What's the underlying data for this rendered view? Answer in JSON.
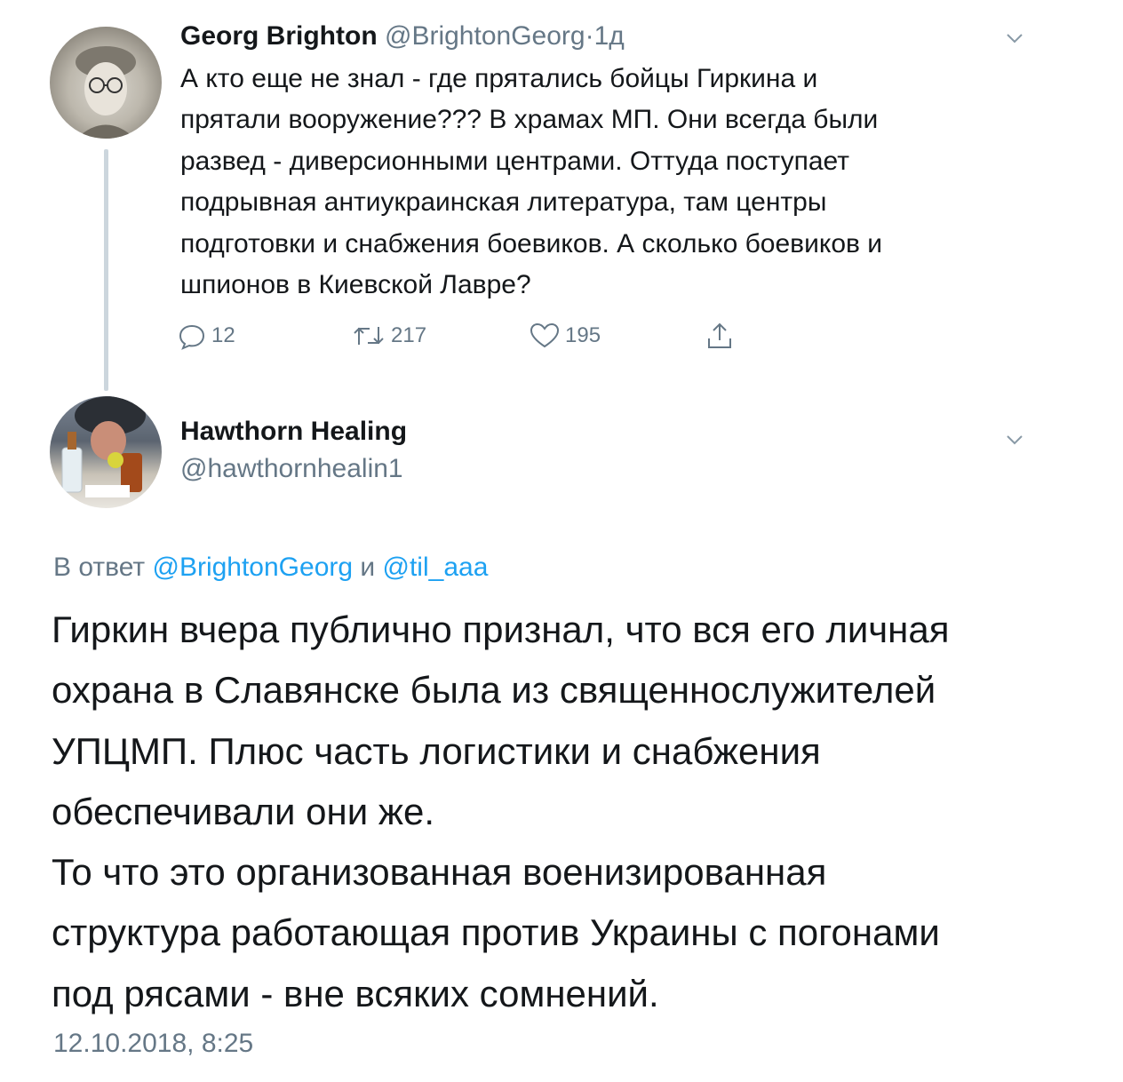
{
  "tweet1": {
    "name": "Georg Brighton",
    "handle": "@BrightonGeorg",
    "separator": "·",
    "age": "1д",
    "text": "А кто еще не знал - где прятались бойцы Гиркина и\nпрятали вооружение??? В храмах МП. Они всегда были\nразвед - диверсионными центрами. Оттуда поступает\nподрывная антиукраинская литература, там центры\nподготовки и снабжения боевиков. А сколько боевиков и\nшпионов в Киевской Лавре?",
    "replies": "12",
    "retweets": "217",
    "likes": "195",
    "icons": [
      "avatar-photo",
      "chevron-down-icon",
      "reply-icon",
      "retweet-icon",
      "like-icon",
      "share-icon"
    ]
  },
  "tweet2": {
    "name": "Hawthorn Healing",
    "handle": "@hawthornhealin1",
    "replying_prefix": "В ответ",
    "reply_to_1": "@BrightonGeorg",
    "conjunction": "и",
    "reply_to_2": "@til_aaa",
    "text": "Гиркин вчера публично признал, что вся его личная\nохрана в Славянске была из священнослужителей\nУПЦМП. Плюс часть логистики и снабжения\nобеспечивали они же.\nТо что это организованная военизированная\nструктура работающая против Украины с погонами\nпод рясами - вне всяких сомнений.",
    "timestamp": "12.10.2018, 8:25"
  },
  "colors": {
    "text": "#14171a",
    "secondary": "#657786",
    "link": "#1da1f2",
    "thread_line": "#ccd6dd"
  }
}
